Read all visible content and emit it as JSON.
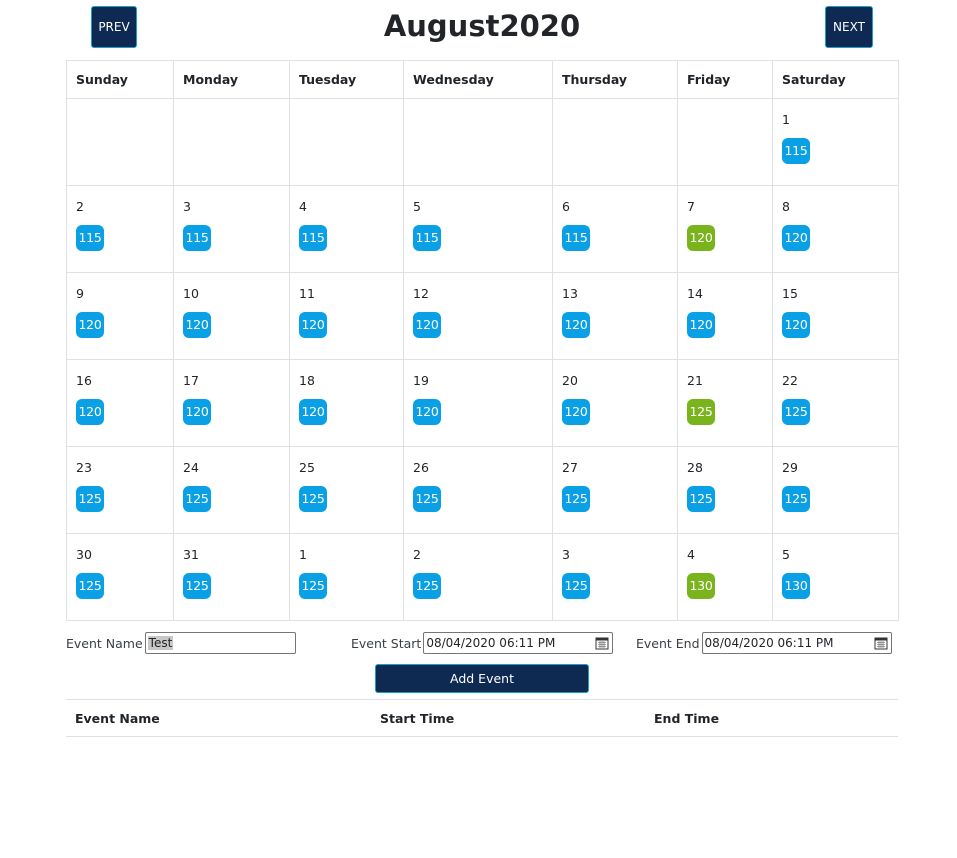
{
  "header": {
    "prev_label": "PREV",
    "next_label": "NEXT",
    "title": "August2020"
  },
  "calendar": {
    "weekdays": [
      "Sunday",
      "Monday",
      "Tuesday",
      "Wednesday",
      "Thursday",
      "Friday",
      "Saturday"
    ],
    "weeks": [
      [
        {
          "day": ""
        },
        {
          "day": ""
        },
        {
          "day": ""
        },
        {
          "day": ""
        },
        {
          "day": ""
        },
        {
          "day": ""
        },
        {
          "day": "1",
          "badge": "115",
          "color": "blue"
        }
      ],
      [
        {
          "day": "2",
          "badge": "115",
          "color": "blue"
        },
        {
          "day": "3",
          "badge": "115",
          "color": "blue"
        },
        {
          "day": "4",
          "badge": "115",
          "color": "blue"
        },
        {
          "day": "5",
          "badge": "115",
          "color": "blue"
        },
        {
          "day": "6",
          "badge": "115",
          "color": "blue"
        },
        {
          "day": "7",
          "badge": "120",
          "color": "green"
        },
        {
          "day": "8",
          "badge": "120",
          "color": "blue"
        }
      ],
      [
        {
          "day": "9",
          "badge": "120",
          "color": "blue"
        },
        {
          "day": "10",
          "badge": "120",
          "color": "blue"
        },
        {
          "day": "11",
          "badge": "120",
          "color": "blue"
        },
        {
          "day": "12",
          "badge": "120",
          "color": "blue"
        },
        {
          "day": "13",
          "badge": "120",
          "color": "blue"
        },
        {
          "day": "14",
          "badge": "120",
          "color": "blue"
        },
        {
          "day": "15",
          "badge": "120",
          "color": "blue"
        }
      ],
      [
        {
          "day": "16",
          "badge": "120",
          "color": "blue"
        },
        {
          "day": "17",
          "badge": "120",
          "color": "blue"
        },
        {
          "day": "18",
          "badge": "120",
          "color": "blue"
        },
        {
          "day": "19",
          "badge": "120",
          "color": "blue"
        },
        {
          "day": "20",
          "badge": "120",
          "color": "blue"
        },
        {
          "day": "21",
          "badge": "125",
          "color": "green"
        },
        {
          "day": "22",
          "badge": "125",
          "color": "blue"
        }
      ],
      [
        {
          "day": "23",
          "badge": "125",
          "color": "blue"
        },
        {
          "day": "24",
          "badge": "125",
          "color": "blue"
        },
        {
          "day": "25",
          "badge": "125",
          "color": "blue"
        },
        {
          "day": "26",
          "badge": "125",
          "color": "blue"
        },
        {
          "day": "27",
          "badge": "125",
          "color": "blue"
        },
        {
          "day": "28",
          "badge": "125",
          "color": "blue"
        },
        {
          "day": "29",
          "badge": "125",
          "color": "blue"
        }
      ],
      [
        {
          "day": "30",
          "badge": "125",
          "color": "blue"
        },
        {
          "day": "31",
          "badge": "125",
          "color": "blue"
        },
        {
          "day": "1",
          "badge": "125",
          "color": "blue"
        },
        {
          "day": "2",
          "badge": "125",
          "color": "blue"
        },
        {
          "day": "3",
          "badge": "125",
          "color": "blue"
        },
        {
          "day": "4",
          "badge": "130",
          "color": "green"
        },
        {
          "day": "5",
          "badge": "130",
          "color": "blue"
        }
      ]
    ],
    "colors": {
      "blue": "#0aa0e6",
      "green": "#79b41d"
    }
  },
  "form": {
    "name_label": "Event Name",
    "name_value": "Test",
    "start_label": "Event Start",
    "start_value": "08/04/2020 06:11 PM",
    "end_label": "Event End",
    "end_value": "08/04/2020 06:11 PM",
    "add_label": "Add Event"
  },
  "events_table": {
    "headers": [
      "Event Name",
      "Start Time",
      "End Time"
    ]
  },
  "theme": {
    "button_bg": "#0e2a52",
    "button_border": "#18a0c8"
  }
}
